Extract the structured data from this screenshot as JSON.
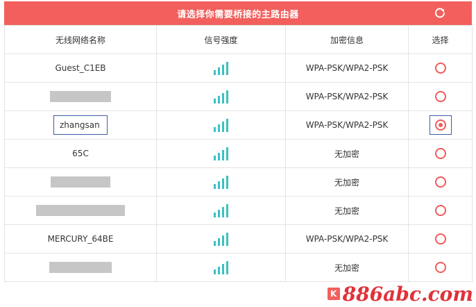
{
  "header": {
    "title": "请选择你需要桥接的主路由器",
    "refresh_icon": "refresh-icon"
  },
  "table": {
    "columns": [
      "无线网络名称",
      "信号强度",
      "加密信息",
      "选择"
    ],
    "rows": [
      {
        "ssid": "Guest_C1EB",
        "encryption": "WPA-PSK/WPA2-PSK",
        "selected": false
      },
      {
        "ssid": "",
        "encryption": "WPA-PSK/WPA2-PSK",
        "selected": false
      },
      {
        "ssid": "zhangsan",
        "encryption": "WPA-PSK/WPA2-PSK",
        "selected": true
      },
      {
        "ssid": "65C",
        "encryption": "无加密",
        "selected": false
      },
      {
        "ssid": "",
        "encryption": "无加密",
        "selected": false
      },
      {
        "ssid": "",
        "encryption": "无加密",
        "selected": false
      },
      {
        "ssid": "MERCURY_64BE",
        "encryption": "WPA-PSK/WPA2-PSK",
        "selected": false
      },
      {
        "ssid": "",
        "encryption": "无加密",
        "selected": false
      }
    ]
  },
  "colors": {
    "accent": "#f25f5c",
    "signal": "#3cc0c4",
    "highlight_border": "#3b5ba5",
    "redacted": "#c6c6c6"
  },
  "watermark": {
    "text": "886abc.com",
    "badge": "K"
  }
}
